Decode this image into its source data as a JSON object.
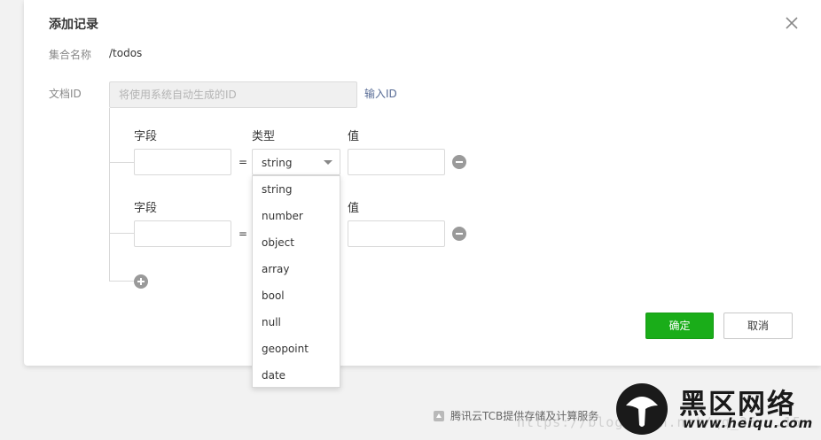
{
  "dialog": {
    "title": "添加记录",
    "collection_label": "集合名称",
    "collection_value": "/todos",
    "docid_label": "文档ID",
    "docid_placeholder": "将使用系统自动生成的ID",
    "input_id_link": "输入ID"
  },
  "fields": {
    "rows": [
      {
        "field_header": "字段",
        "type_header": "类型",
        "value_header": "值",
        "field_value": "",
        "type_value": "string",
        "value_value": "",
        "eq": "="
      },
      {
        "field_header": "字段",
        "value_header": "值",
        "field_value": "",
        "value_value": "",
        "eq": "="
      }
    ]
  },
  "type_dropdown": {
    "options": [
      "string",
      "number",
      "object",
      "array",
      "bool",
      "null",
      "geopoint",
      "date"
    ],
    "selected": "string"
  },
  "buttons": {
    "confirm": "确定",
    "cancel": "取消"
  },
  "footer": {
    "text": "腾讯云TCB提供存储及计算服务"
  },
  "watermark": {
    "url": "https://blog.csdn.net/qq_36...15",
    "cn": "黑区网络",
    "en": "www.heiqu.com"
  },
  "colors": {
    "primary": "#1aad19",
    "link": "#576b95",
    "text": "#353535",
    "muted": "#888888"
  },
  "icons": {
    "close": "close-icon",
    "remove": "minus-circle-icon",
    "add": "plus-circle-icon",
    "caret": "caret-down-icon"
  }
}
